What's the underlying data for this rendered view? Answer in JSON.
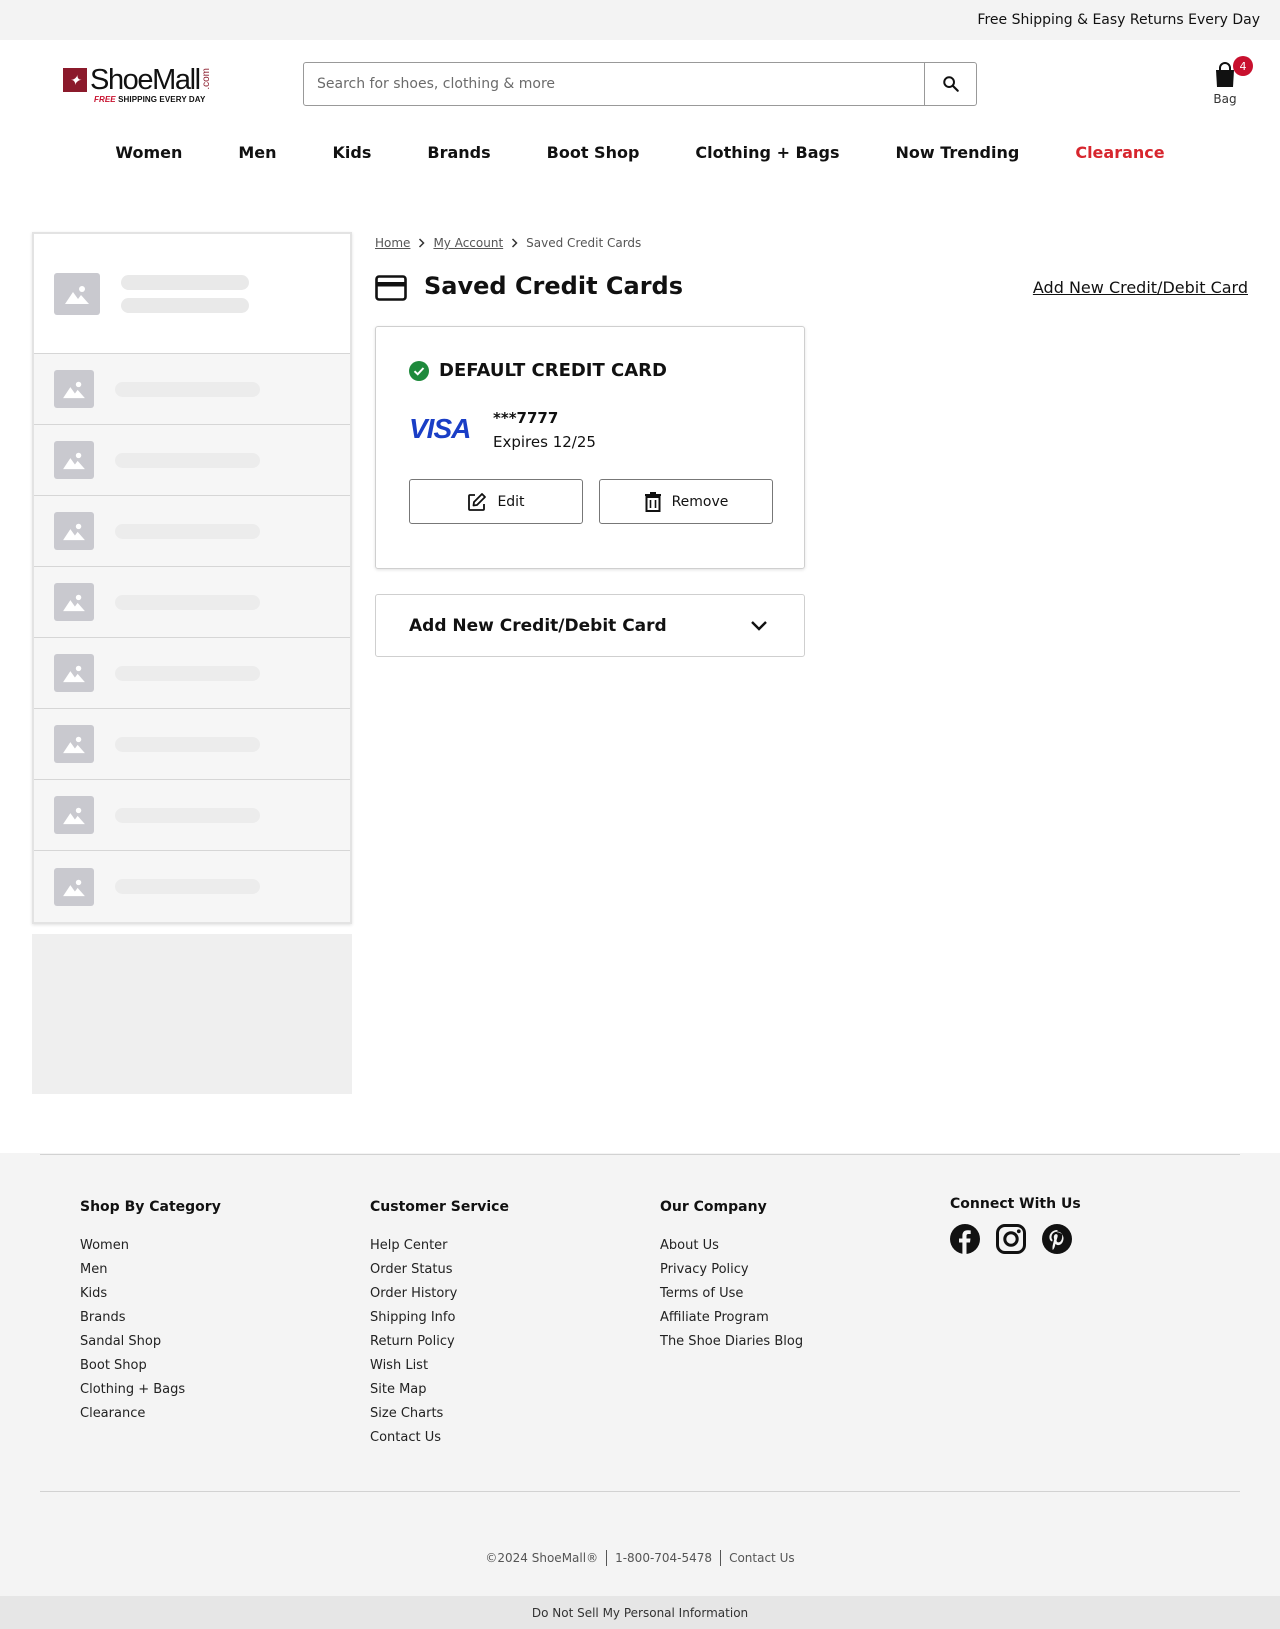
{
  "topbar": {
    "promo": "Free Shipping & Easy Returns Every Day"
  },
  "logo": {
    "brand": "ShoeMall",
    "com": ".com",
    "tag_free": "FREE",
    "tag_rest": " SHIPPING EVERY DAY"
  },
  "search": {
    "placeholder": "Search for shoes, clothing & more",
    "icon": "search-icon"
  },
  "bag": {
    "label": "Bag",
    "count": "4",
    "icon": "shopping-bag-icon"
  },
  "nav": {
    "items": [
      "Women",
      "Men",
      "Kids",
      "Brands",
      "Boot Shop",
      "Clothing + Bags",
      "Now Trending",
      "Clearance"
    ],
    "clearance_color": "#d7262e"
  },
  "breadcrumb": {
    "home": "Home",
    "account": "My Account",
    "current": "Saved Credit Cards"
  },
  "page": {
    "title": "Saved Credit Cards",
    "add_link": "Add New Credit/Debit Card"
  },
  "card": {
    "default_label": "DEFAULT CREDIT CARD",
    "brand": "VISA",
    "number": "***7777",
    "expires": "Expires 12/25",
    "edit_label": "Edit",
    "remove_label": "Remove",
    "check_color": "#1e8a3c",
    "visa_color": "#1a3ec6"
  },
  "accordion": {
    "label": "Add New Credit/Debit Card"
  },
  "footer": {
    "shop": {
      "heading": "Shop By Category",
      "links": [
        "Women",
        "Men",
        "Kids",
        "Brands",
        "Sandal Shop",
        "Boot Shop",
        "Clothing + Bags",
        "Clearance"
      ]
    },
    "service": {
      "heading": "Customer Service",
      "links": [
        "Help Center",
        "Order Status",
        "Order History",
        "Shipping Info",
        "Return Policy",
        "Wish List",
        "Site Map",
        "Size Charts",
        "Contact Us"
      ]
    },
    "company": {
      "heading": "Our Company",
      "links": [
        "About Us",
        "Privacy Policy",
        "Terms of Use",
        "Affiliate Program",
        "The Shoe Diaries Blog"
      ]
    },
    "connect": {
      "heading": "Connect With Us",
      "icons": [
        "facebook-icon",
        "instagram-icon",
        "pinterest-icon"
      ]
    },
    "legal": {
      "copyright": "©2024 ShoeMall®",
      "phone": "1-800-704-5478",
      "contact": "Contact Us"
    },
    "dnsmpi": "Do Not Sell My Personal Information"
  }
}
